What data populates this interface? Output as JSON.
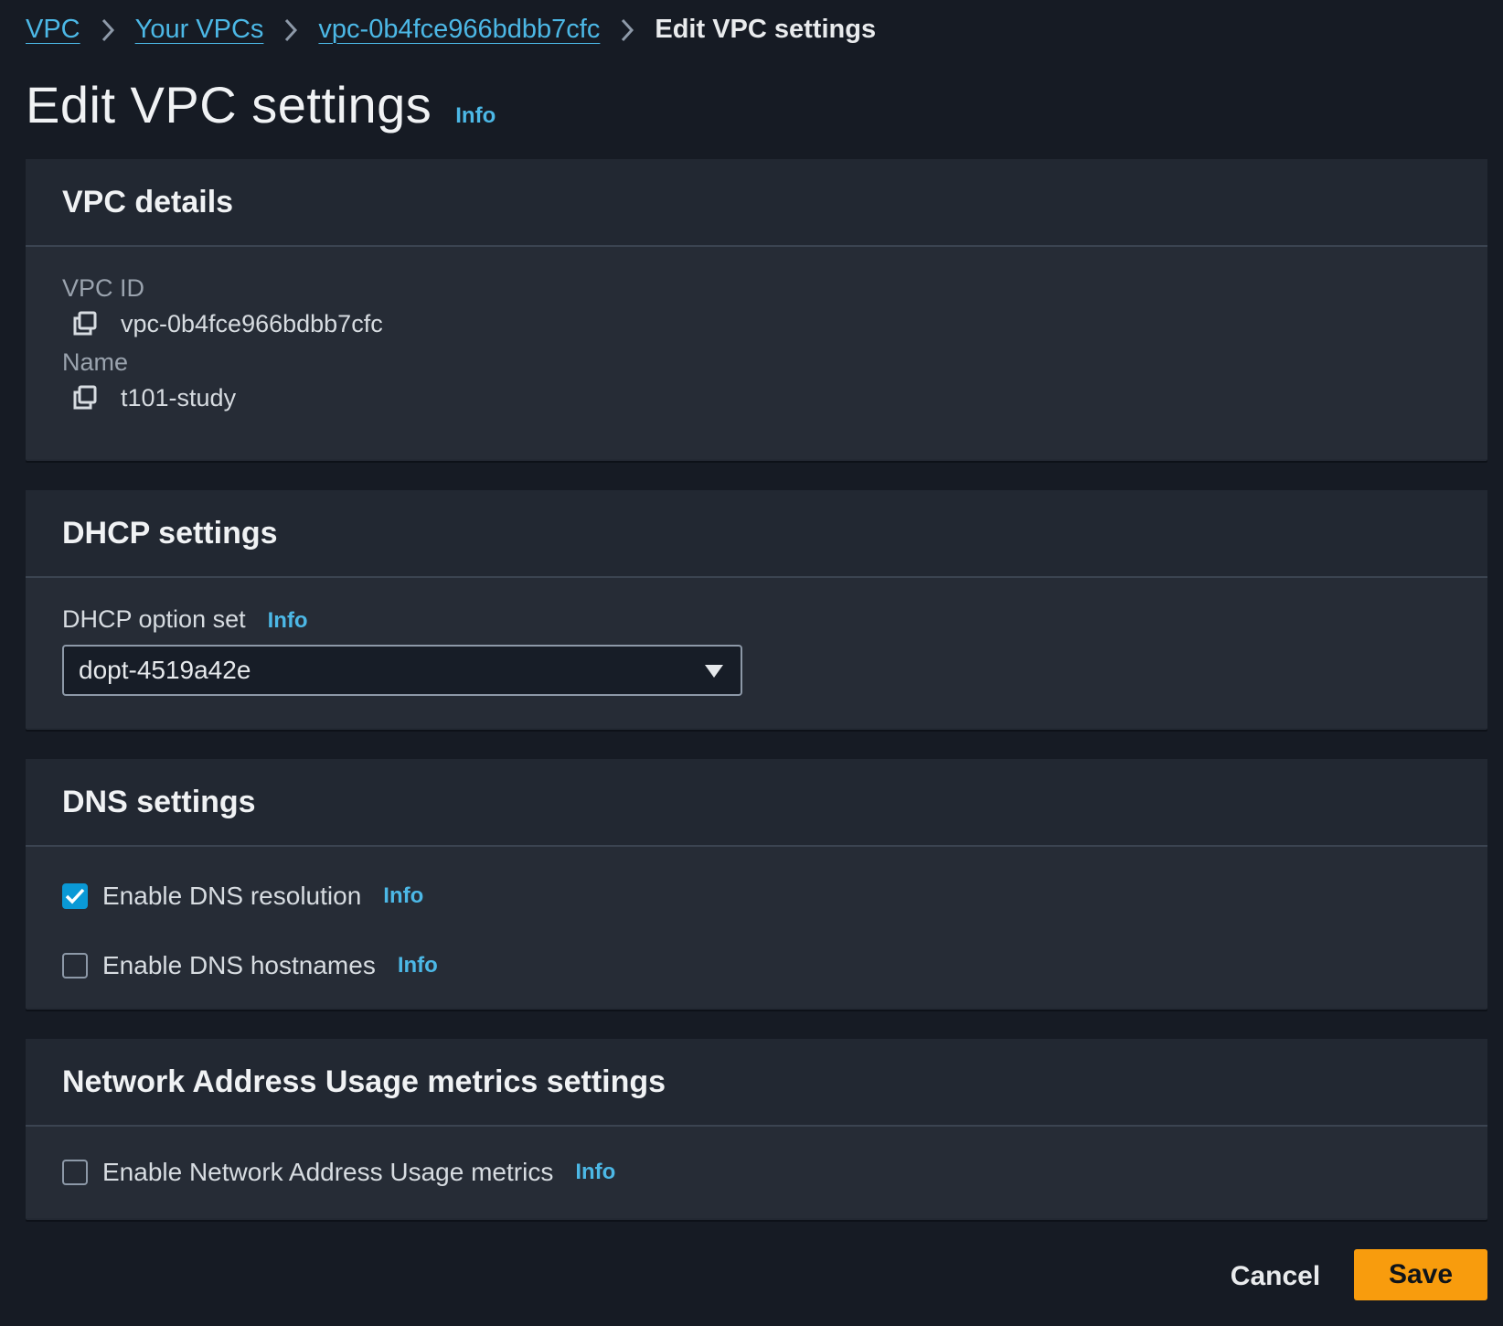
{
  "breadcrumb": {
    "items": [
      "VPC",
      "Your VPCs",
      "vpc-0b4fce966bdbb7cfc"
    ],
    "current": "Edit VPC settings"
  },
  "header": {
    "title": "Edit VPC settings",
    "info": "Info"
  },
  "vpc_details": {
    "title": "VPC details",
    "vpc_id_label": "VPC ID",
    "vpc_id_value": "vpc-0b4fce966bdbb7cfc",
    "name_label": "Name",
    "name_value": "t101-study"
  },
  "dhcp": {
    "title": "DHCP settings",
    "option_set_label": "DHCP option set",
    "info": "Info",
    "selected_value": "dopt-4519a42e"
  },
  "dns": {
    "title": "DNS settings",
    "resolution_label": "Enable DNS resolution",
    "resolution_checked": true,
    "hostnames_label": "Enable DNS hostnames",
    "hostnames_checked": false,
    "info": "Info"
  },
  "nau": {
    "title": "Network Address Usage metrics settings",
    "metrics_label": "Enable Network Address Usage metrics",
    "metrics_checked": false,
    "info": "Info"
  },
  "footer": {
    "cancel_label": "Cancel",
    "save_label": "Save"
  },
  "colors": {
    "accent": "#0a99d6",
    "link": "#4cb8e6",
    "primary_button": "#f89c0d",
    "background": "#161b24"
  },
  "icons": {
    "copy": "copy-icon",
    "caret": "caret-down-icon",
    "chevron": "chevron-right-icon",
    "check": "checkmark-icon"
  }
}
